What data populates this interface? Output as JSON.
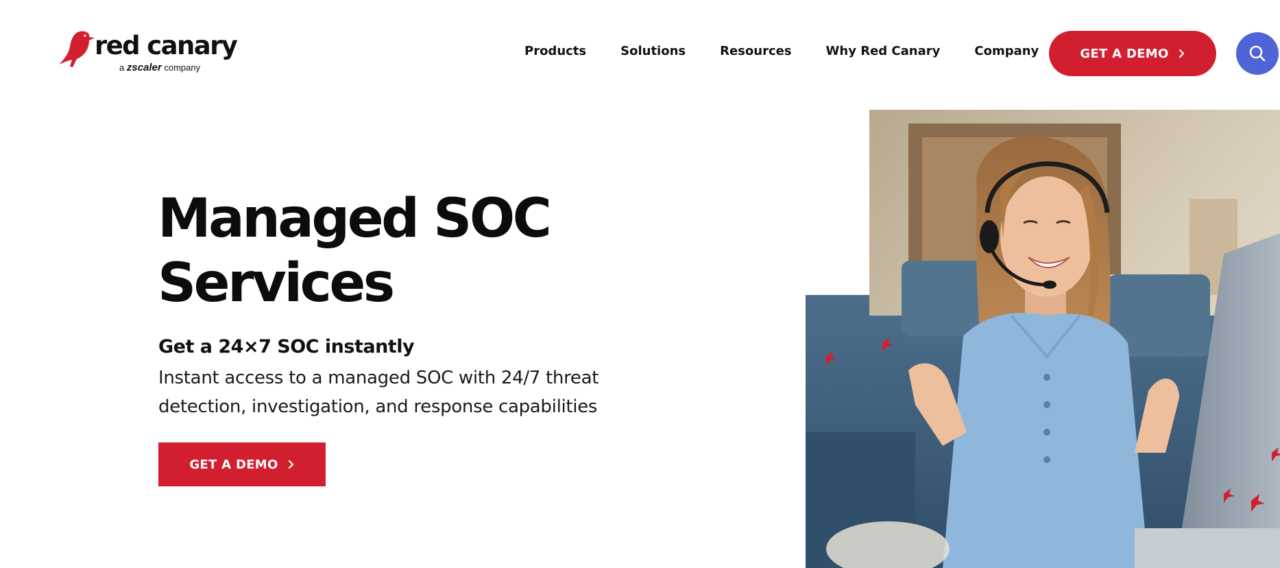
{
  "brand": {
    "name": "red canary",
    "tagline_prefix": "a",
    "tagline_brand": "zscaler",
    "tagline_suffix": "company",
    "accent_color": "#d21f30",
    "search_color": "#4f64d6"
  },
  "nav": {
    "items": [
      {
        "label": "Products"
      },
      {
        "label": "Solutions"
      },
      {
        "label": "Resources"
      },
      {
        "label": "Why Red Canary"
      },
      {
        "label": "Company"
      }
    ],
    "cta_label": "GET A DEMO",
    "cta_icon": "chevron-right-icon",
    "search_icon": "search-icon"
  },
  "hero": {
    "title_line1": "Managed SOC",
    "title_line2": "Services",
    "subtitle": "Get a 24×7 SOC instantly",
    "description": "Instant access to a managed SOC with 24/7 threat detection, investigation, and response capabilities",
    "cta_label": "GET A DEMO",
    "image": "woman-with-headset-photo"
  }
}
